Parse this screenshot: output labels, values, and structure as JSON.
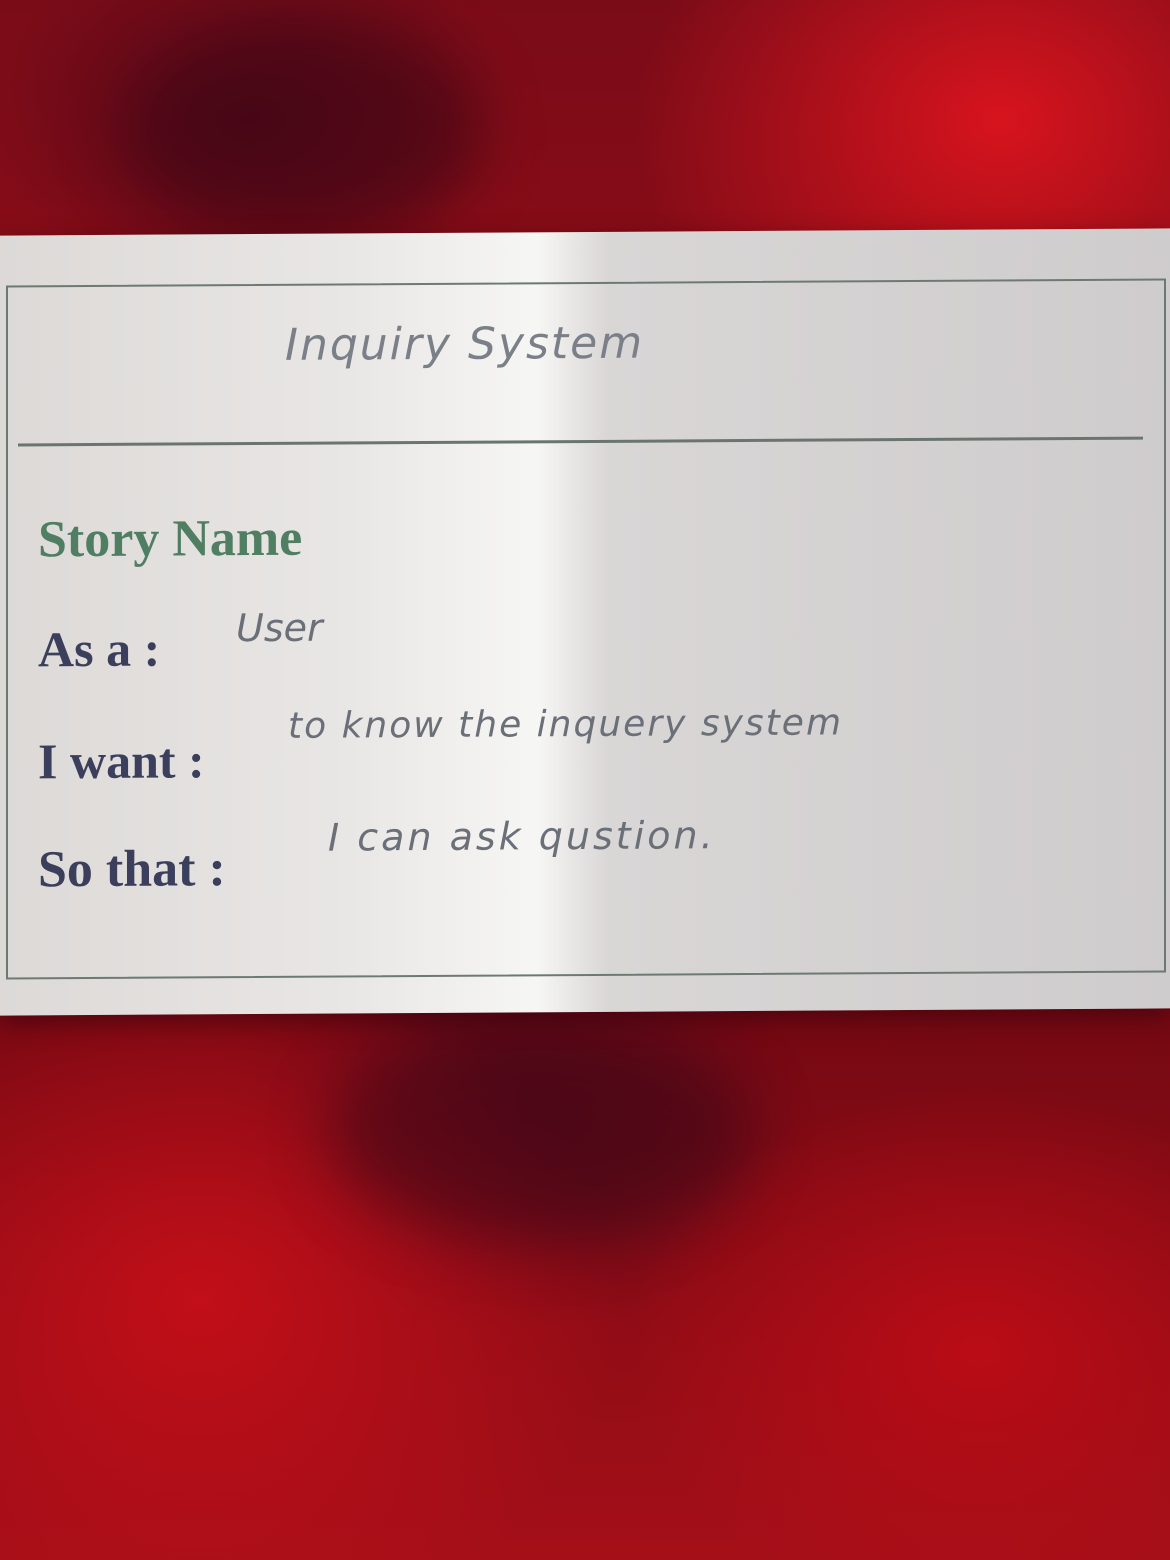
{
  "card": {
    "title": "Inquiry System",
    "story_name_label": "Story Name",
    "as_a_label": "As a :",
    "as_a_value": "User",
    "i_want_label": "I want :",
    "i_want_value": "to know the inquery system",
    "so_that_label": "So that :",
    "so_that_value": "I can ask qustion."
  },
  "colors": {
    "background": "#8a0a12",
    "card": "#e9e7e5",
    "label_text": "#3b3f5c",
    "story_name_text": "#4f7e62",
    "handwriting": "#6a6f78"
  }
}
